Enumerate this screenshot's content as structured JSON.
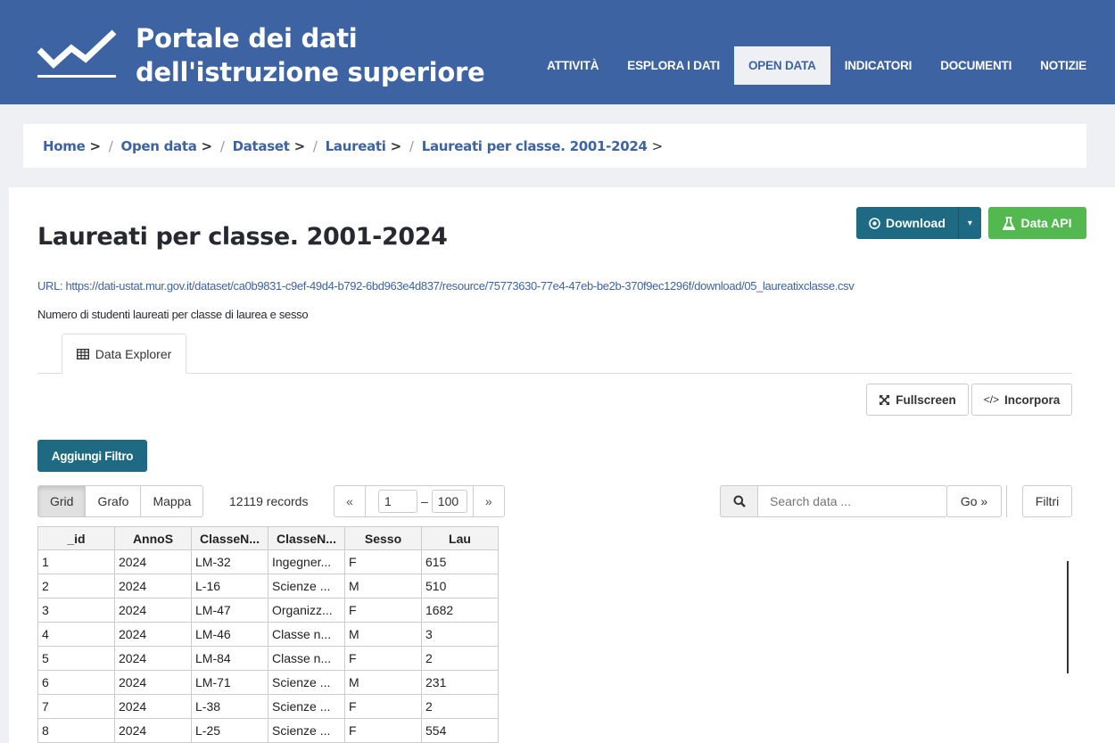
{
  "header": {
    "brand_line1": "Portale dei dati",
    "brand_line2": "dell'istruzione superiore",
    "nav": [
      {
        "label": "ATTIVITÀ",
        "active": false
      },
      {
        "label": "ESPLORA I DATI",
        "active": false
      },
      {
        "label": "OPEN DATA",
        "active": true
      },
      {
        "label": "INDICATORI",
        "active": false
      },
      {
        "label": "DOCUMENTI",
        "active": false
      },
      {
        "label": "NOTIZIE",
        "active": false
      }
    ],
    "color": "#3d63a2"
  },
  "breadcrumb": [
    {
      "label": "Home",
      "sep": ">"
    },
    {
      "label": "Open data",
      "sep": ">"
    },
    {
      "label": "Dataset",
      "sep": ">"
    },
    {
      "label": "Laureati",
      "sep": ">"
    },
    {
      "label": "Laureati per classe. 2001-2024",
      "sep": ">"
    }
  ],
  "resource": {
    "title": "Laureati per classe. 2001-2024",
    "download_label": "Download",
    "api_label": "Data API",
    "url_label": "URL:",
    "url": "https://dati-ustat.mur.gov.it/dataset/ca0b9831-c9ef-49d4-b792-6bd963e4d837/resource/75773630-77e4-47eb-be2b-370f9ec1296f/download/05_laureatixclasse.csv",
    "description": "Numero di studenti laureati per classe di laurea e sesso"
  },
  "tabs": [
    {
      "label": "Data Explorer",
      "icon": "table-icon"
    }
  ],
  "actions": {
    "fullscreen_label": "Fullscreen",
    "embed_label": "Incorpora",
    "add_filter_label": "Aggiungi Filtro"
  },
  "explorer": {
    "views": [
      "Grid",
      "Grafo",
      "Mappa"
    ],
    "active_view": "Grid",
    "records_text": "12119 records",
    "pager_prev": "«",
    "pager_next": "»",
    "from": "1",
    "to": "100",
    "dash": "–",
    "search_placeholder": "Search data ...",
    "go_label": "Go »",
    "filters_label": "Filtri"
  },
  "grid": {
    "columns": [
      "_id",
      "AnnoS",
      "ClasseN...",
      "ClasseN...",
      "Sesso",
      "Lau"
    ],
    "rows": [
      [
        "1",
        "2024",
        "LM-32",
        "Ingegner...",
        "F",
        "615"
      ],
      [
        "2",
        "2024",
        "L-16",
        "Scienze ...",
        "M",
        "510"
      ],
      [
        "3",
        "2024",
        "LM-47",
        "Organizz...",
        "F",
        "1682"
      ],
      [
        "4",
        "2024",
        "LM-46",
        "Classe n...",
        "M",
        "3"
      ],
      [
        "5",
        "2024",
        "LM-84",
        "Classe n...",
        "F",
        "2"
      ],
      [
        "6",
        "2024",
        "LM-71",
        "Scienze ...",
        "M",
        "231"
      ],
      [
        "7",
        "2024",
        "L-38",
        "Scienze ...",
        "F",
        "2"
      ],
      [
        "8",
        "2024",
        "L-25",
        "Scienze ...",
        "F",
        "554"
      ]
    ]
  }
}
